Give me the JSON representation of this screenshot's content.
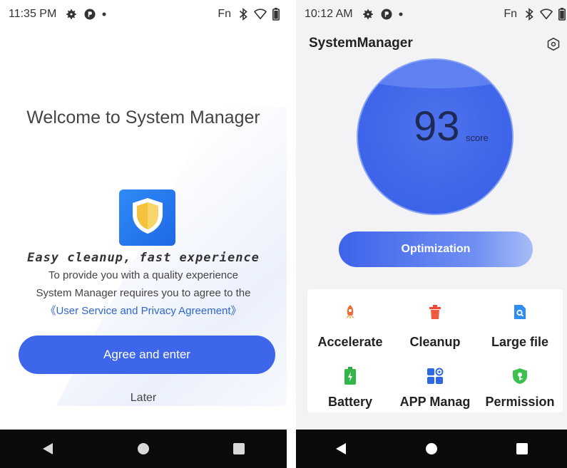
{
  "left": {
    "status": {
      "time": "11:35 PM",
      "fn": "Fn"
    },
    "welcome_title": "Welcome to System Manager",
    "tagline": "Easy cleanup, fast experience",
    "description_line1": "To provide you with a quality experience",
    "description_line2": "System Manager requires you to agree to the",
    "agreement_link": "《User Service and Privacy Agreement》",
    "agree_button": "Agree and enter",
    "later_button": "Later"
  },
  "right": {
    "status": {
      "time": "10:12 AM",
      "fn": "Fn"
    },
    "app_title": "SystemManager",
    "score": {
      "value": "93",
      "label": "score"
    },
    "optimize_button": "Optimization",
    "tools": [
      {
        "label": "Accelerate",
        "icon": "rocket-icon",
        "color": "#f06a3a"
      },
      {
        "label": "Cleanup",
        "icon": "trash-icon",
        "color": "#f04a35"
      },
      {
        "label": "Large file",
        "icon": "file-search-icon",
        "color": "#2f8cf0"
      },
      {
        "label": "Battery",
        "icon": "battery-icon",
        "color": "#33b54a"
      },
      {
        "label": "APP Manag",
        "icon": "app-grid-icon",
        "color": "#2f66e6"
      },
      {
        "label": "Permission",
        "icon": "shield-key-icon",
        "color": "#3cc04e"
      }
    ]
  },
  "colors": {
    "primary": "#3d66ea",
    "link": "#2f66d0",
    "nav_bar": "#0a0a0a",
    "right_background": "#f3f3f5"
  }
}
